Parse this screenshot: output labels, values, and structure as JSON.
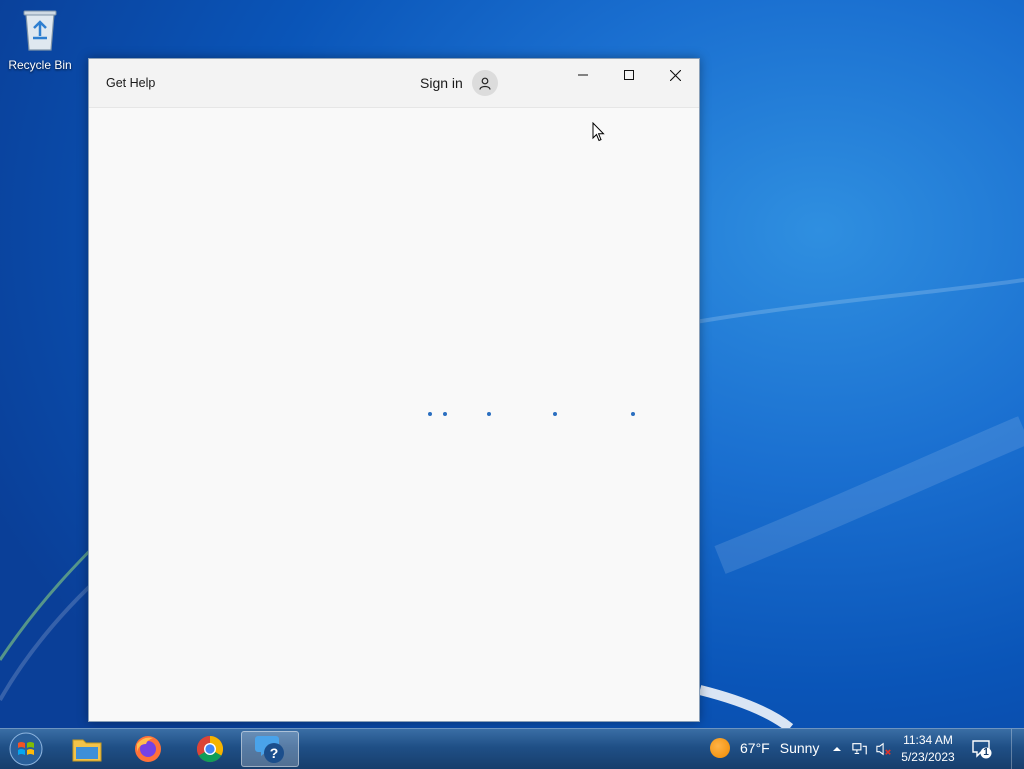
{
  "desktop": {
    "icons": [
      {
        "label": "Recycle Bin",
        "icon": "recycle-bin-icon"
      }
    ]
  },
  "window": {
    "title": "Get Help",
    "sign_in_label": "Sign in",
    "controls": {
      "minimize": "minimize-icon",
      "maximize": "maximize-icon",
      "close": "close-icon"
    },
    "content": {
      "state": "loading",
      "indicator": "loading-dots",
      "accent": "#2b6fc0"
    }
  },
  "taskbar": {
    "apps": [
      {
        "name": "start-button",
        "icon": "windows-logo-icon"
      },
      {
        "name": "file-explorer",
        "icon": "folder-icon"
      },
      {
        "name": "firefox",
        "icon": "firefox-icon"
      },
      {
        "name": "chrome",
        "icon": "chrome-icon"
      },
      {
        "name": "get-help",
        "icon": "get-help-icon",
        "active": true
      }
    ],
    "tray": {
      "weather_temp": "67°F",
      "weather_condition": "Sunny",
      "time": "11:34 AM",
      "date": "5/23/2023",
      "notification_count": "1"
    }
  }
}
